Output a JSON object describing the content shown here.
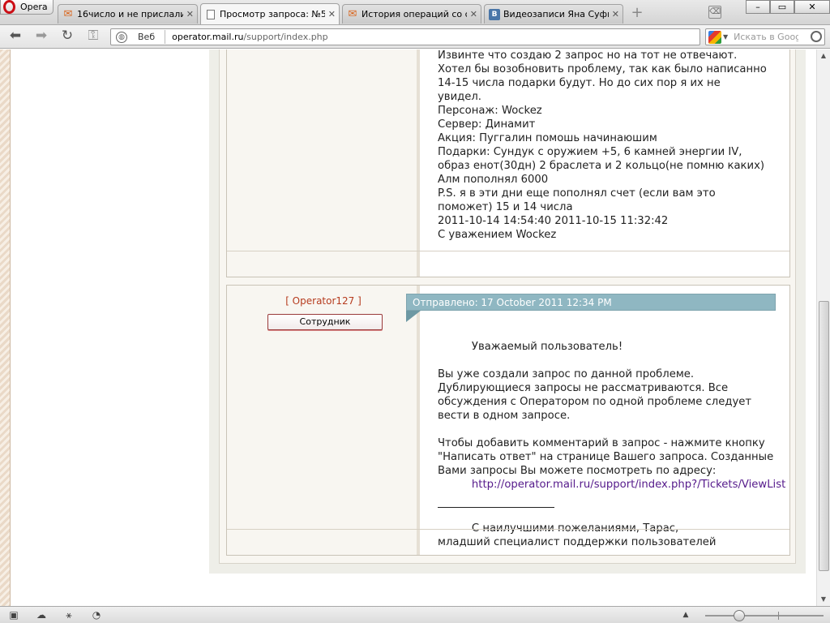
{
  "browser": {
    "menu_label": "Opera",
    "tabs": [
      {
        "label": "16число и не прислали ...",
        "icon": "mailru-icon",
        "active": false
      },
      {
        "label": "Просмотр запроса: №5...",
        "icon": "page-icon",
        "active": true
      },
      {
        "label": "История операций со с...",
        "icon": "mailru-icon",
        "active": false
      },
      {
        "label": "Видеозаписи Яна Суфи...",
        "icon": "vk-icon",
        "active": false
      }
    ],
    "close_glyph": "✕",
    "newtab_glyph": "+",
    "window_buttons": [
      "–",
      "▭",
      "✕"
    ]
  },
  "toolbar": {
    "back_glyph": "⬅",
    "forward_glyph": "➡",
    "reload_glyph": "↻",
    "key_glyph": "⚿",
    "web_label": "Веб",
    "url_domain": "operator.mail.ru",
    "url_path": "/support/index.php",
    "search_placeholder": "Искать в Googl"
  },
  "posts": [
    {
      "body": "Извинте что создаю 2 запрос но на тот не отвечают.\nХотел бы возобновить проблему, так как было написанно\n14-15 числа подарки будут. Но до сих пор я их не\nувидел.\nПерсонаж: Wockez\nСервер: Динамит\nАкция: Пуггалин помошь начинаюшим\nПодарки: Сундук с оружием +5, 6 камней энергии IV,\nобраз енот(30дн) 2 браслета и 2 кольцо(не помню каких)\nАлм пополнял 6000\nP.S. я в эти дни еще пополнял счет (если вам это\nпоможет) 15 и 14 числа\n2011-10-14 14:54:40 2011-10-15 11:32:42\nС уважением Wockez"
    },
    {
      "author": "[ Operator127 ]",
      "role": "Сотрудник",
      "sent": "Отправлено: 17 October 2011 12:34 PM",
      "body_intro": "Уважаемый пользователь!\n\nВы уже создали запрос по данной проблеме.\nДублирующиеся запросы не рассматриваются. Все\nобсуждения с Оператором по одной проблеме следует\nвести в одном запросе.\n\nЧтобы добавить комментарий в запрос - нажмите кнопку\n\"Написать ответ\" на странице Вашего запроса. Созданные\nВами запросы Вы можете посмотреть по адресу:",
      "link": "http://operator.mail.ru/support/index.php?/Tickets/ViewList",
      "signature": "С наилучшими пожеланиями, Тарас,\nмладший специалист поддержки пользователей"
    }
  ],
  "scrollbar": {
    "up_glyph": "▲",
    "down_glyph": "▼"
  },
  "statusbar": {
    "icons": [
      "panel-toggle-icon",
      "turbo-cloud-icon",
      "share-icon",
      "speed-dial-icon"
    ],
    "zoom_arrow": "▲"
  }
}
